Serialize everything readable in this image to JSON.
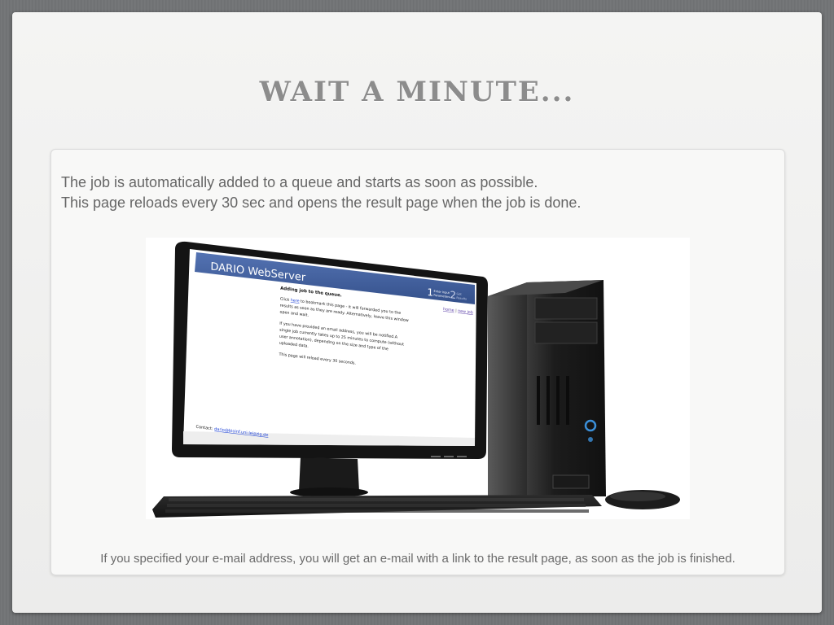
{
  "slide": {
    "title": "WAIT A MINUTE...",
    "intro_line_1": "The job is automatically added to a queue and starts as soon as possible.",
    "intro_line_2": "This page reloads every 30 sec and opens the result page when the job is done.",
    "footer_note": "If you specified your e-mail address, you will get an e-mail with a link to the result page, as soon as the job is finished."
  },
  "screen": {
    "app_title": "DARIO WebServer",
    "step_1_number": "1",
    "step_1_label_a": "Enter input",
    "step_1_label_b": "Parameters",
    "step_2_number": "2",
    "step_2_label_a": "Get",
    "step_2_label_b": "Results",
    "nav_home": "home",
    "nav_separator": "|",
    "nav_new_job": "new job",
    "heading": "Adding job to the queue.",
    "para1_prefix": "Click ",
    "para1_link": "here",
    "para1_rest": " to bookmark this page - it will forwarded you to the",
    "para1_line2": "results as soon as they are ready. Alternatively, leave this window",
    "para1_line3": "open and wait.",
    "para2_line1": "If you have provided an email address, you will be notified.A",
    "para2_line2": "single job currently takes up to 25 minutes to compute (without",
    "para2_line3": "user annotation), depending on the size and type of the",
    "para2_line4": "uploaded data.",
    "para3": "This page will reload every 30 seconds.",
    "contact_label": "Contact: ",
    "contact_email": "dario@bioinf.uni-leipzig.de"
  },
  "colors": {
    "header_blue": "#3d5a94",
    "link_blue": "#1a3fd6",
    "power_led": "#3b8fd8"
  },
  "icons": {
    "image": "desktop-computer-illustration"
  }
}
